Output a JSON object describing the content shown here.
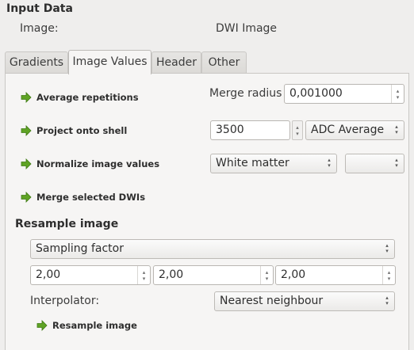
{
  "input_data": {
    "title": "Input Data",
    "image_label": "Image:",
    "image_value": "DWI Image"
  },
  "tabs": [
    {
      "label": "Gradients",
      "active": false
    },
    {
      "label": "Image Values",
      "active": true
    },
    {
      "label": "Header",
      "active": false
    },
    {
      "label": "Other",
      "active": false
    }
  ],
  "actions": {
    "average_repetitions": "Average repetitions",
    "project_onto_shell": "Project onto shell",
    "normalize_image_values": "Normalize image values",
    "merge_selected_dwis": "Merge selected DWIs",
    "resample_image": "Resample image"
  },
  "merge": {
    "label": "Merge radius",
    "value": "0,001000"
  },
  "project": {
    "shell_value": "3500",
    "method": "ADC Average"
  },
  "normalize": {
    "reference": "White matter",
    "secondary": ""
  },
  "resample": {
    "title": "Resample image",
    "mode": "Sampling factor",
    "factors": [
      "2,00",
      "2,00",
      "2,00"
    ],
    "interpolator_label": "Interpolator:",
    "interpolator": "Nearest neighbour"
  },
  "icons": {
    "action_arrow": "green-arrow-icon",
    "spin_up": "▴",
    "spin_down": "▾"
  },
  "colors": {
    "arrow_green": "#5fa324",
    "background": "#efeeed",
    "panel": "#f6f5f4"
  }
}
